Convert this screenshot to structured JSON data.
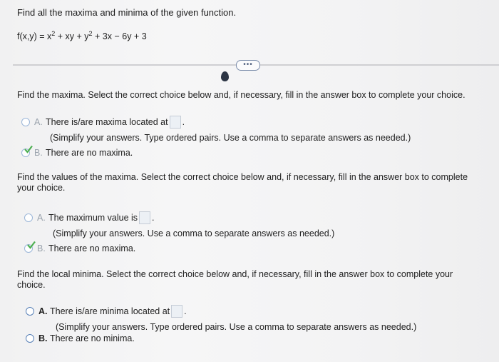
{
  "header": {
    "prompt": "Find all the maxima and minima of the given function.",
    "function_prefix": "f(x,y) = x",
    "function_mid1": " + xy + y",
    "function_exp": "2",
    "function_suffix": " + 3x − 6y + 3",
    "more_button": "•••"
  },
  "q1": {
    "text": "Find the maxima. Select the correct choice below and, if necessary, fill in the answer box to complete your choice.",
    "a_letter": "A.",
    "a_text": "There is/are maxima located at",
    "a_hint": "(Simplify your answers. Type ordered pairs. Use a comma to separate answers as needed.)",
    "b_letter": "B.",
    "b_text": "There are no maxima."
  },
  "q2": {
    "text_line1": "Find the values of the maxima. Select the correct choice below and, if necessary, fill in the answer box to complete",
    "text_line2": "your choice.",
    "a_letter": "A.",
    "a_text": "The maximum value is",
    "a_hint": "(Simplify your answers. Use a comma to separate answers as needed.)",
    "b_letter": "B.",
    "b_text": "There are no maxima."
  },
  "q3": {
    "text_line1": "Find the local minima. Select the correct choice below and, if necessary, fill in the answer box to complete your",
    "text_line2": "choice.",
    "a_letter": "A.",
    "a_text": "There is/are minima located at",
    "a_hint": "(Simplify your answers. Type ordered pairs. Use a comma to separate answers as needed.)",
    "b_letter": "B.",
    "b_text": "There are no minima."
  },
  "colors": {
    "radio": "#5a82b8",
    "check": "#4caf50"
  }
}
